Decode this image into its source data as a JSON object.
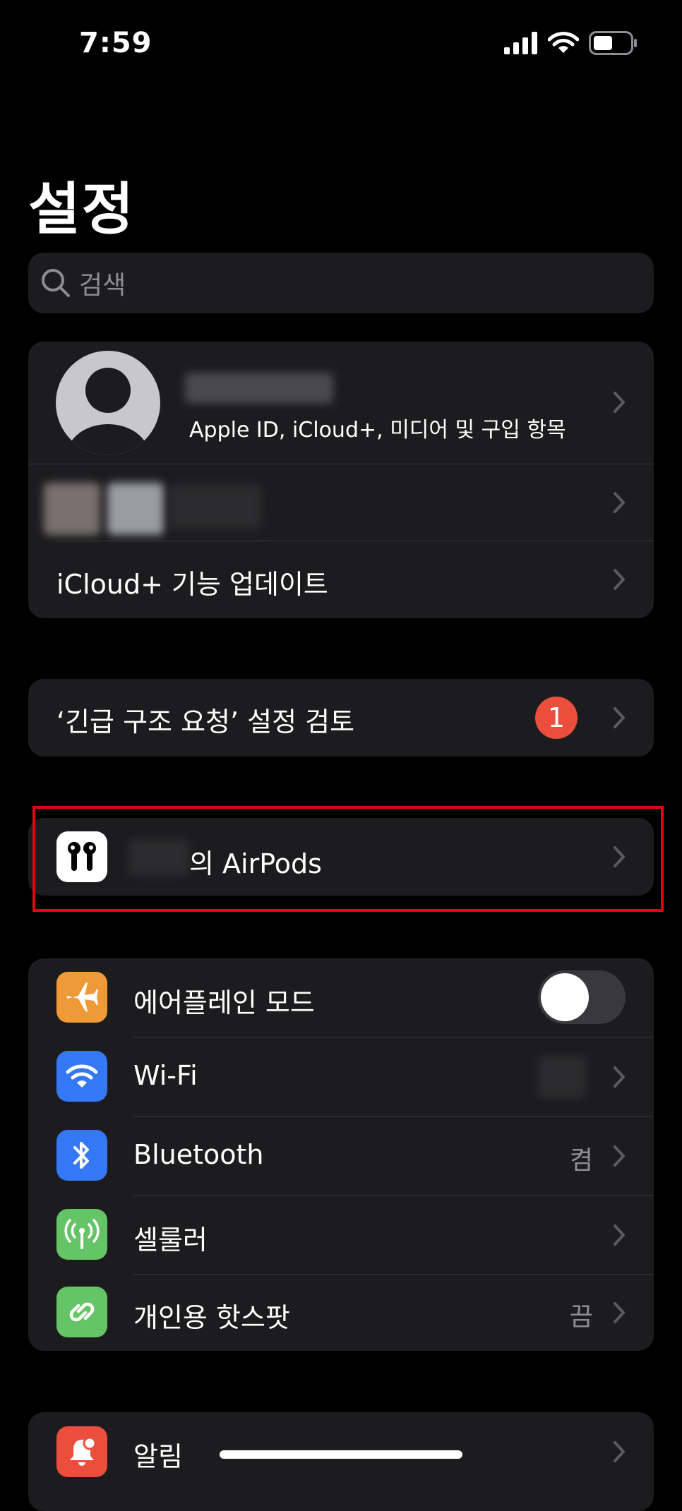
{
  "status_bar": {
    "time": "7:59"
  },
  "page_title": "설정",
  "search": {
    "placeholder": "검색"
  },
  "account": {
    "subtitle": "Apple ID, iCloud+, 미디어 및 구입 항목",
    "icloud_update": "iCloud+ 기능 업데이트"
  },
  "emergency": {
    "label": "‘긴급 구조 요청’ 설정 검토",
    "badge": "1"
  },
  "airpods": {
    "label": "의 AirPods"
  },
  "connectivity": [
    {
      "label": "에어플레인 모드",
      "icon": "airplane-icon",
      "color": "#f09a37",
      "toggle": false
    },
    {
      "label": "Wi-Fi",
      "icon": "wifi-icon",
      "color": "#3478f6",
      "value": ""
    },
    {
      "label": "Bluetooth",
      "icon": "bluetooth-icon",
      "color": "#3478f6",
      "value": "켬"
    },
    {
      "label": "셀룰러",
      "icon": "cellular-icon",
      "color": "#65c466",
      "value": ""
    },
    {
      "label": "개인용 핫스팟",
      "icon": "hotspot-icon",
      "color": "#65c466",
      "value": "끔"
    }
  ],
  "notifications": {
    "label": "알림",
    "icon": "bell-icon",
    "color": "#eb4e3d"
  }
}
